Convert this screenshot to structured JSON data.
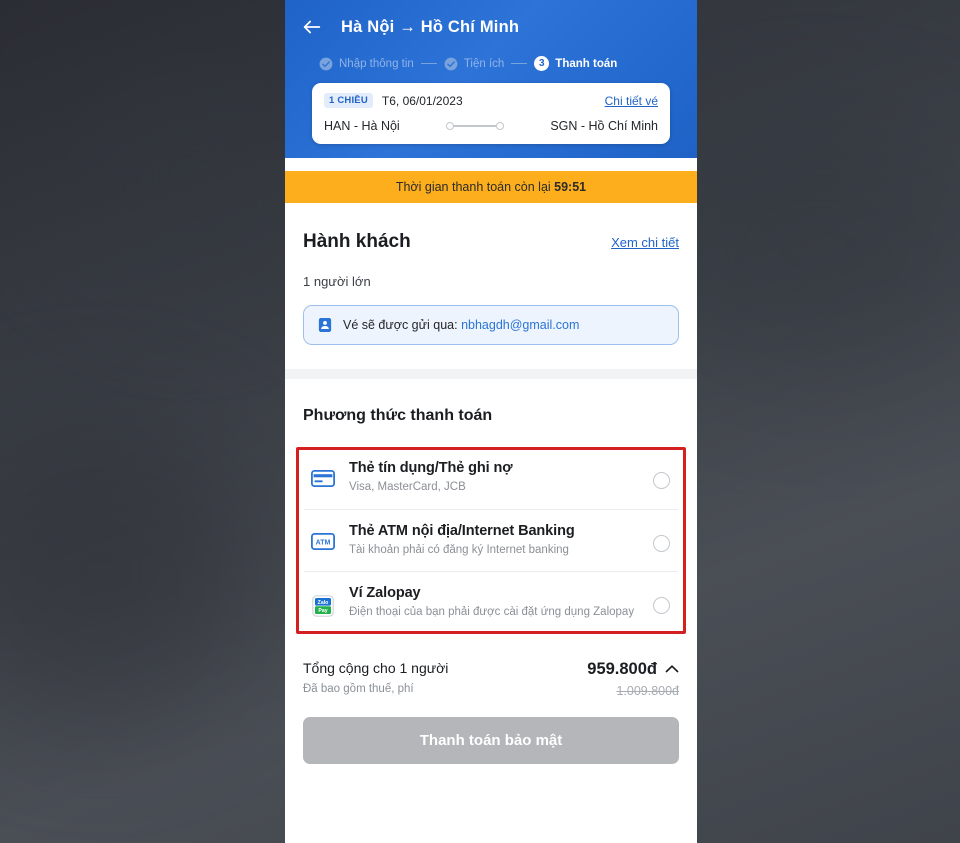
{
  "header": {
    "back_icon": "back-arrow-icon",
    "route_title": "Hà Nội → Hồ Chí Minh",
    "steps": [
      {
        "label": "Nhập thông tin",
        "state": "done",
        "icon": "check-circle-icon"
      },
      {
        "label": "Tiện ích",
        "state": "done",
        "icon": "check-circle-icon"
      },
      {
        "label": "Thanh toán",
        "state": "active",
        "number": "3"
      }
    ]
  },
  "flight_card": {
    "trip_badge": "1 CHIỀU",
    "date": "T6, 06/01/2023",
    "detail_link": "Chi tiết vé",
    "origin": "HAN - Hà Nội",
    "destination": "SGN - Hồ Chí Minh"
  },
  "timer": {
    "prefix": "Thời gian thanh toán còn lại ",
    "value": "59:51"
  },
  "passenger": {
    "title": "Hành khách",
    "detail_link": "Xem chi tiết",
    "count": "1 người lớn",
    "email_notice_prefix": "Vé sẽ được gửi qua: ",
    "email": "nbhagdh@gmail.com",
    "email_icon": "contact-card-icon"
  },
  "payment": {
    "title": "Phương thức thanh toán",
    "highlight_color": "#d32020",
    "methods": [
      {
        "name": "Thẻ tín dụng/Thẻ ghi nợ",
        "sub": "Visa, MasterCard, JCB",
        "icon": "credit-card-icon",
        "selected": false
      },
      {
        "name": "Thẻ ATM nội địa/Internet Banking",
        "sub": "Tài khoản phải có đăng ký Internet banking",
        "icon": "atm-card-icon",
        "icon_label": "ATM",
        "selected": false
      },
      {
        "name": "Ví Zalopay",
        "sub": "Điện thoại của bạn phải được cài đặt ứng dụng Zalopay",
        "icon": "zalopay-logo-icon",
        "icon_label": "Zalo",
        "selected": false
      }
    ]
  },
  "total": {
    "label": "Tổng cộng cho 1 người",
    "sub": "Đã bao gồm thuế, phí",
    "price": "959.800đ",
    "old_price": "1.009.800đ",
    "expand_icon": "chevron-up-icon",
    "submit_label": "Thanh toán bảo mật"
  },
  "colors": {
    "brand_blue": "#1f63c8",
    "timer_orange": "#FDAE1C",
    "highlight_red": "#d32020",
    "disabled_gray": "#b4b6b9"
  }
}
